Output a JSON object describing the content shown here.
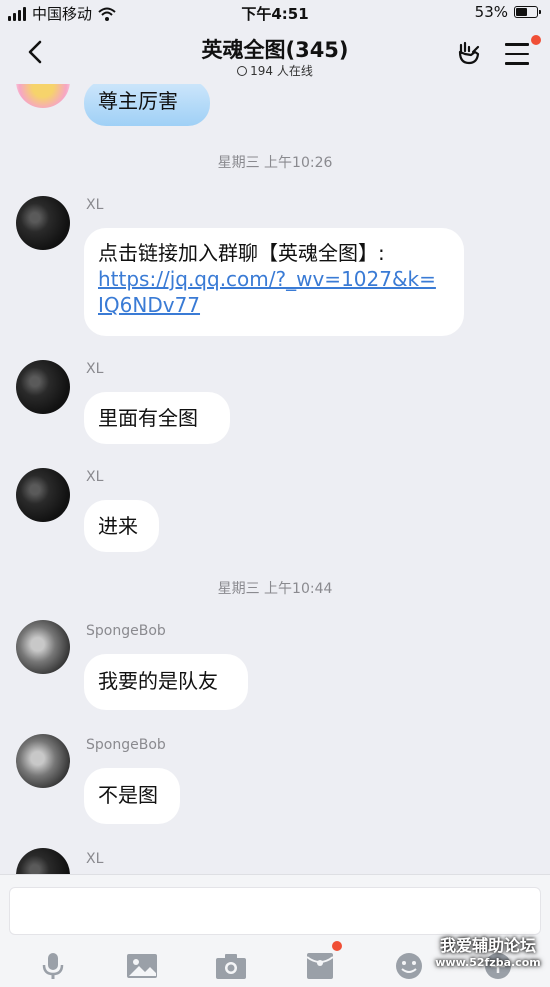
{
  "status_bar": {
    "carrier": "中国移动",
    "time": "下午4:51",
    "battery": "53%"
  },
  "nav": {
    "title": "英魂全图(345)",
    "online": "194 人在线"
  },
  "messages": {
    "m0": {
      "text": "尊主厉害"
    },
    "ts1": "星期三 上午10:26",
    "m1": {
      "sender": "XL",
      "text_a": "点击链接加入群聊【英魂全图】:",
      "link": "https://jq.qq.com/?_wv=1027&k=IQ6NDv77"
    },
    "m2": {
      "sender": "XL",
      "text": "里面有全图"
    },
    "m3": {
      "sender": "XL",
      "text": "进来"
    },
    "ts2": "星期三 上午10:44",
    "m4": {
      "sender": "SpongeBob",
      "text": "我要的是队友"
    },
    "m5": {
      "sender": "SpongeBob",
      "text": "不是图"
    },
    "m6": {
      "sender": "XL"
    }
  },
  "watermark": {
    "line1": "我爱辅助论坛",
    "line2": "www.52fzba.com"
  },
  "colors": {
    "background": "#edeef3",
    "link": "#3a7bd5",
    "badge": "#f04f36"
  },
  "icons": [
    "signal-icon",
    "wifi-icon",
    "battery-icon",
    "back-icon",
    "hand-icon",
    "menu-icon",
    "mic-icon",
    "image-icon",
    "camera-icon",
    "red-packet-icon",
    "emoji-icon",
    "plus-icon"
  ]
}
